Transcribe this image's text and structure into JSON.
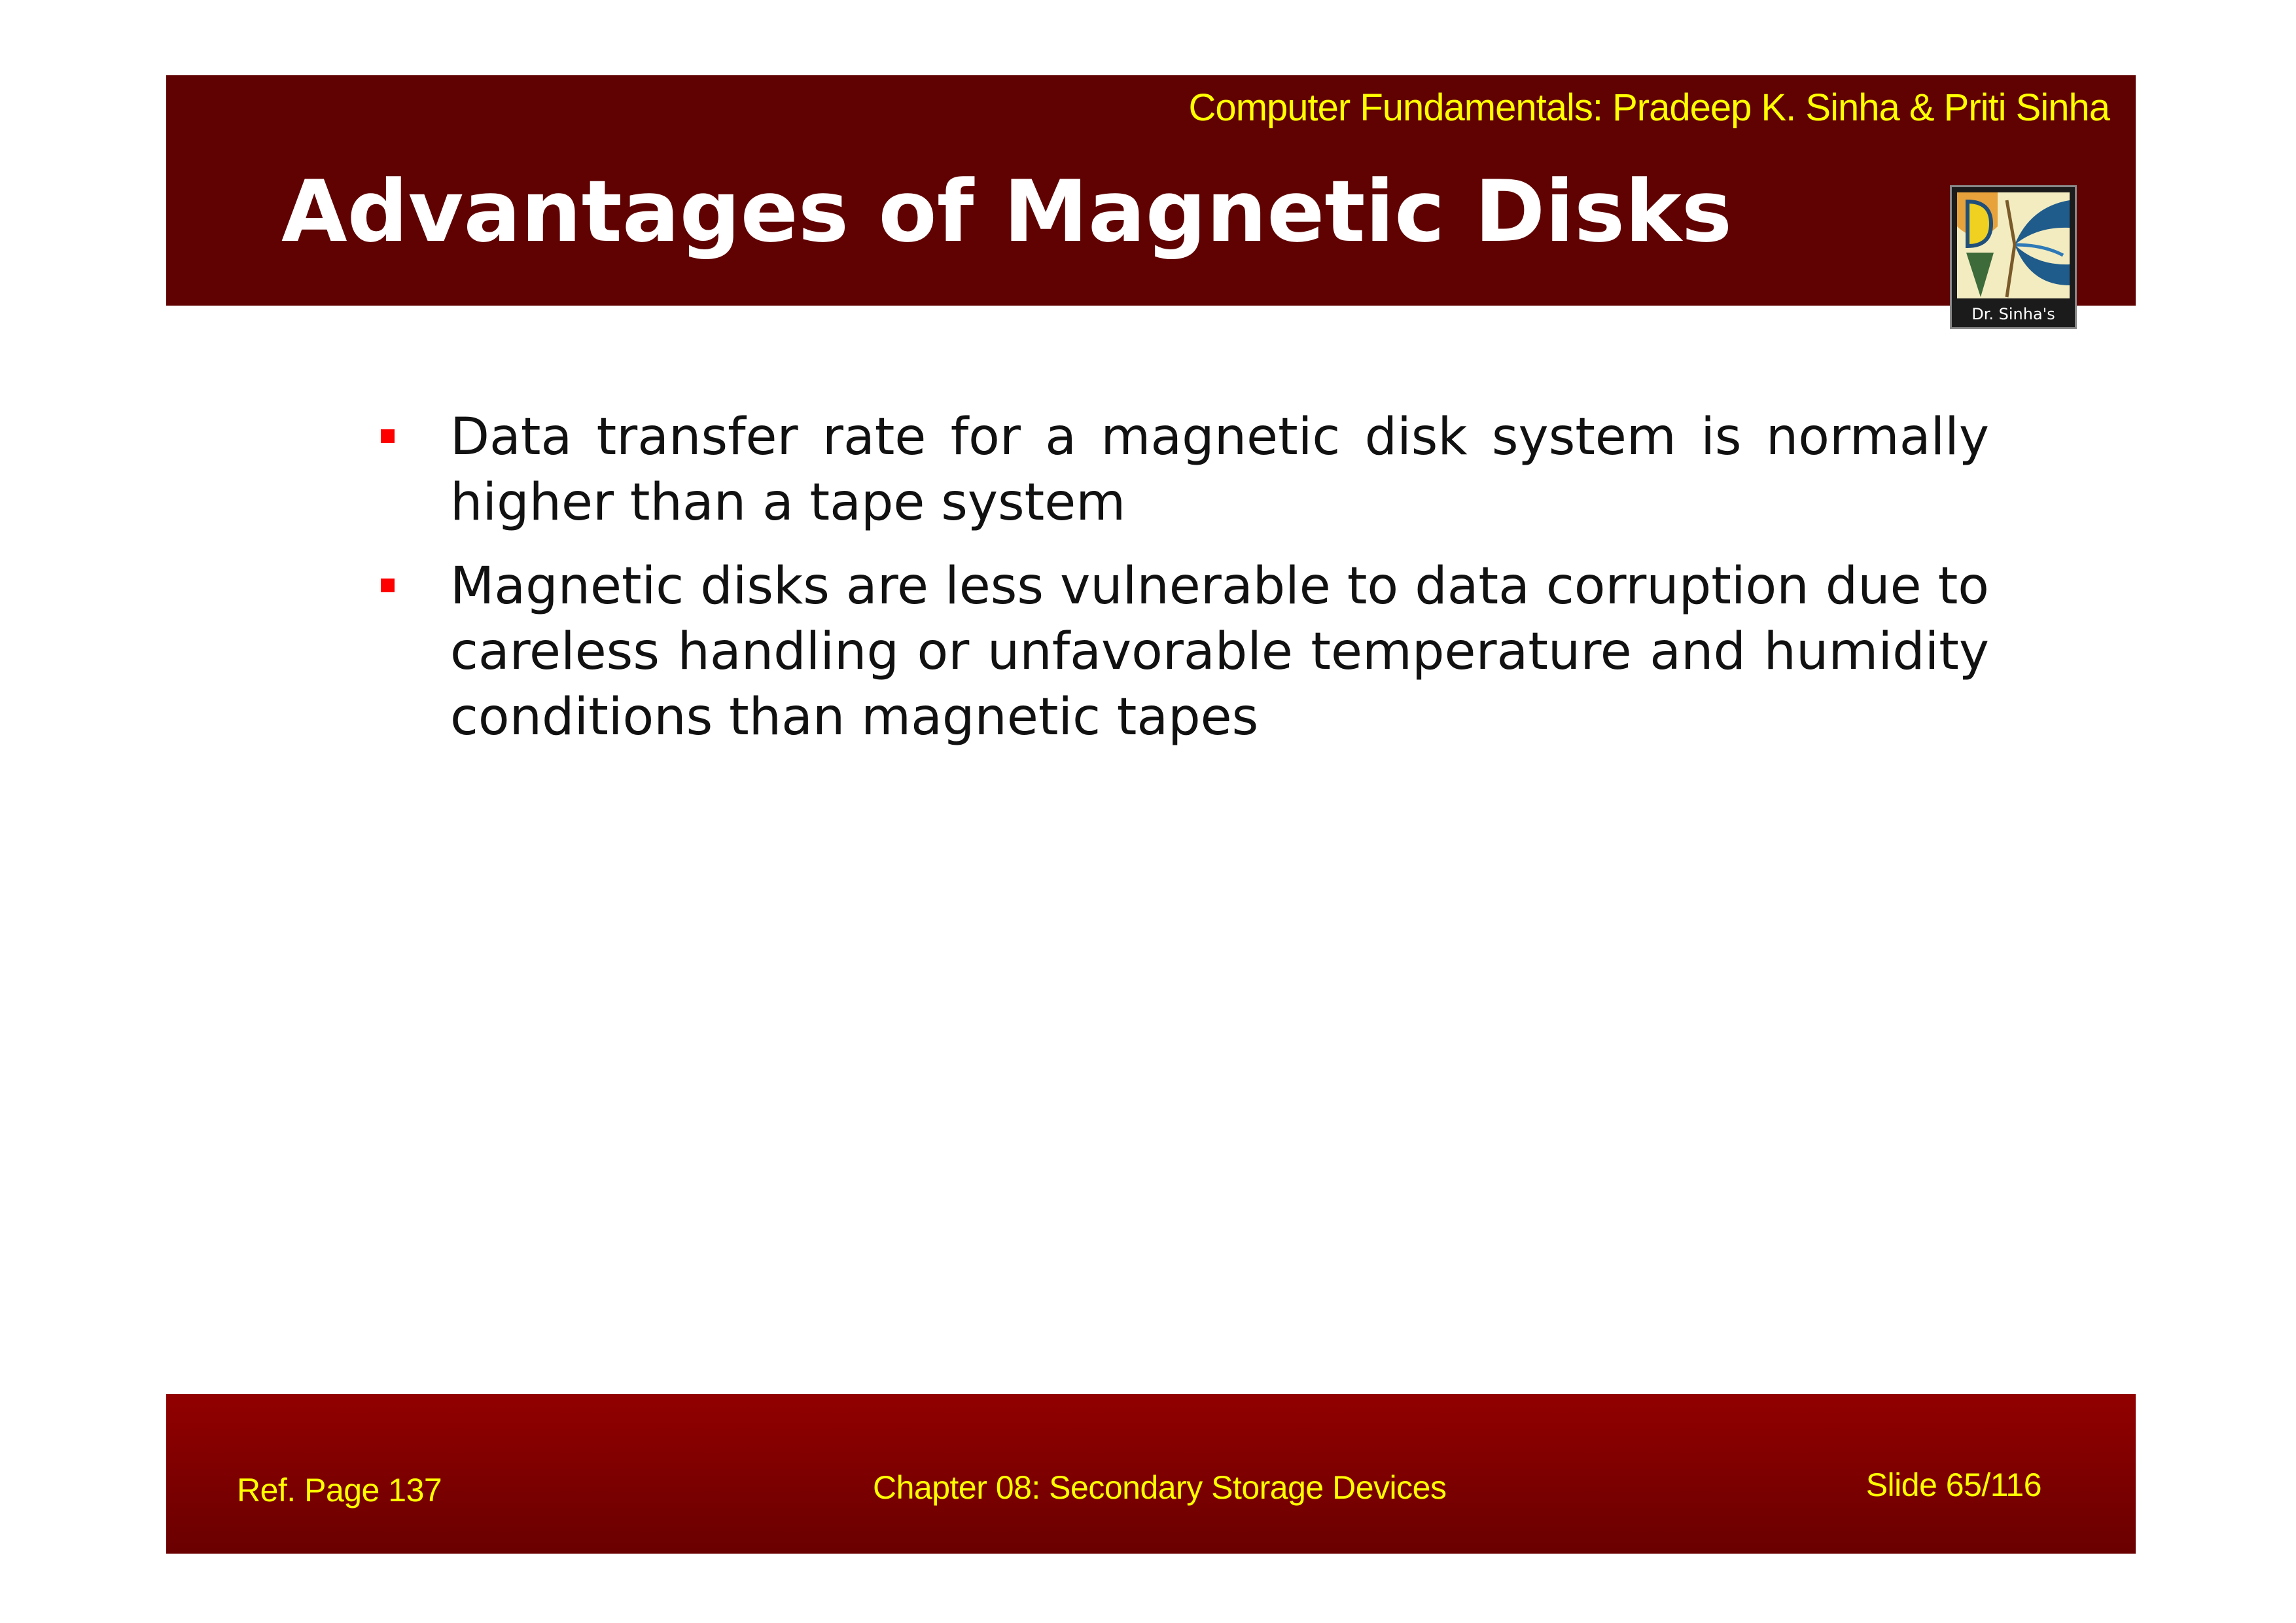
{
  "header": {
    "credit": "Computer Fundamentals: Pradeep K. Sinha & Priti Sinha",
    "title": "Advantages of Magnetic Disks",
    "logo_caption": "Dr. Sinha's"
  },
  "content": {
    "bullets": [
      "Data transfer rate for a magnetic disk system is normally higher than a tape system",
      "Magnetic disks are less vulnerable to data corruption due to careless handling or unfavorable temperature and humidity conditions than magnetic tapes"
    ]
  },
  "footer": {
    "ref_page": "Ref. Page  137",
    "chapter": "Chapter 08: Secondary Storage Devices",
    "slide_number": "Slide 65/116"
  },
  "colors": {
    "header_bg": "#600202",
    "footer_bg": "#920000",
    "accent_text": "#ffff00",
    "bullet": "#ff0000"
  },
  "icons": {
    "logo": "dr-sinha-logo-icon",
    "bullet": "square-bullet-icon"
  }
}
